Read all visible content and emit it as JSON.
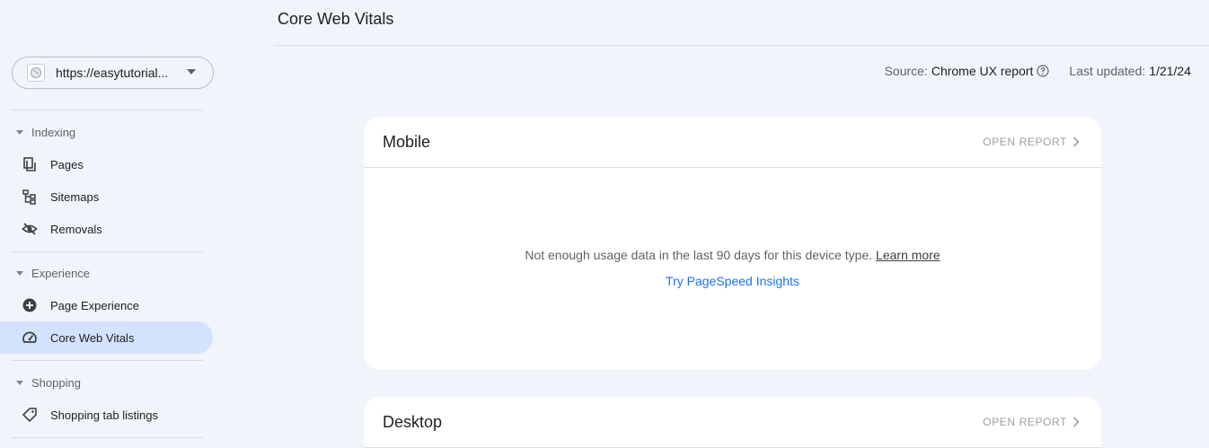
{
  "header": {
    "title": "Core Web Vitals"
  },
  "property": {
    "url": "https://easytutorial...",
    "icon": "globe-icon"
  },
  "sidebar": {
    "sections": [
      {
        "label": "Indexing",
        "items": [
          {
            "label": "Pages",
            "icon": "pages-icon"
          },
          {
            "label": "Sitemaps",
            "icon": "sitemap-icon"
          },
          {
            "label": "Removals",
            "icon": "eye-off-icon"
          }
        ]
      },
      {
        "label": "Experience",
        "items": [
          {
            "label": "Page Experience",
            "icon": "plus-circle-icon"
          },
          {
            "label": "Core Web Vitals",
            "icon": "gauge-icon",
            "active": true
          }
        ]
      },
      {
        "label": "Shopping",
        "items": [
          {
            "label": "Shopping tab listings",
            "icon": "tag-icon"
          }
        ]
      }
    ]
  },
  "meta": {
    "source_label": "Source:",
    "source_value": "Chrome UX report",
    "updated_label": "Last updated:",
    "updated_value": "1/21/24"
  },
  "cards": [
    {
      "title": "Mobile",
      "open_report": "OPEN REPORT",
      "message": "Not enough usage data in the last 90 days for this device type.",
      "learn_more": "Learn more",
      "psi_link": "Try PageSpeed Insights"
    },
    {
      "title": "Desktop",
      "open_report": "OPEN REPORT"
    }
  ],
  "colors": {
    "background": "#f1f4fb",
    "active_nav": "#d3e3fd",
    "link": "#1a73e8"
  }
}
